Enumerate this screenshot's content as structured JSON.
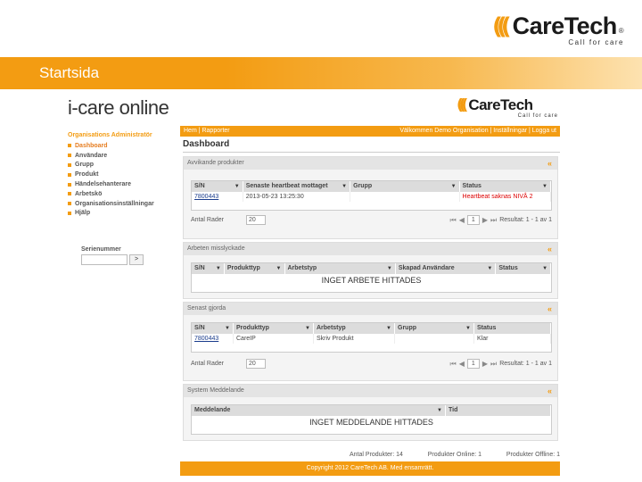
{
  "slide": {
    "logo_text": "CareTech",
    "logo_tagline": "Call for care",
    "logo_reg": "®",
    "banner_title": "Startsida"
  },
  "app": {
    "brand_prefix": "i-care",
    "brand_suffix": " online",
    "logo_text": "CareTech",
    "logo_tagline": "Call for care",
    "top_left": "Hem | Rapporter",
    "top_right": "Välkommen Demo Organisation | Inställningar | Logga ut",
    "sidebar": {
      "header": "Organisations Administratör",
      "items": [
        {
          "label": "Dashboard"
        },
        {
          "label": "Användare"
        },
        {
          "label": "Grupp"
        },
        {
          "label": "Produkt"
        },
        {
          "label": "Händelsehanterare"
        },
        {
          "label": "Arbetskö"
        },
        {
          "label": "Organisationsinställningar"
        },
        {
          "label": "Hjälp"
        }
      ],
      "serienummer_label": "Serienummer",
      "go_label": ">"
    },
    "page_title": "Dashboard",
    "panels": {
      "p1": {
        "title": "Avvikande produkter",
        "columns": [
          "S/N",
          "Senaste heartbeat mottaget",
          "Grupp",
          "Status"
        ],
        "rows": [
          {
            "sn": "7800443",
            "heartbeat": "2013-05-23 13:25:30",
            "grupp": "",
            "status": "Heartbeat saknas NIVÅ 2"
          }
        ],
        "rows_label": "Antal Rader",
        "rows_value": "20",
        "page": "1",
        "result": "Resultat: 1 - 1 av 1"
      },
      "p2": {
        "title": "Arbeten misslyckade",
        "columns": [
          "S/N",
          "Produkttyp",
          "Arbetstyp",
          "Skapad Användare",
          "Status"
        ],
        "empty": "INGET ARBETE HITTADES"
      },
      "p3": {
        "title": "Senast gjorda",
        "columns": [
          "S/N",
          "Produkttyp",
          "Arbetstyp",
          "Grupp",
          "Status"
        ],
        "rows": [
          {
            "sn": "7800443",
            "typ": "CareIP",
            "arbetstyp": "Skriv Produkt",
            "grupp": "",
            "status": "Klar"
          }
        ],
        "rows_label": "Antal Rader",
        "rows_value": "20",
        "page": "1",
        "result": "Resultat: 1 - 1 av 1"
      },
      "p4": {
        "title": "System Meddelande",
        "columns": [
          "Meddelande",
          "Tid"
        ],
        "empty": "INGET MEDDELANDE HITTADES"
      }
    },
    "stats": {
      "total": "Antal Produkter: 14",
      "online": "Produkter Online: 1",
      "offline": "Produkter Offline: 1"
    },
    "copyright": "Copyright 2012 CareTech AB. Med ensamrätt."
  },
  "colors": {
    "accent": "#f39c12",
    "link": "#1a3c8c",
    "alert": "#dd0000"
  }
}
